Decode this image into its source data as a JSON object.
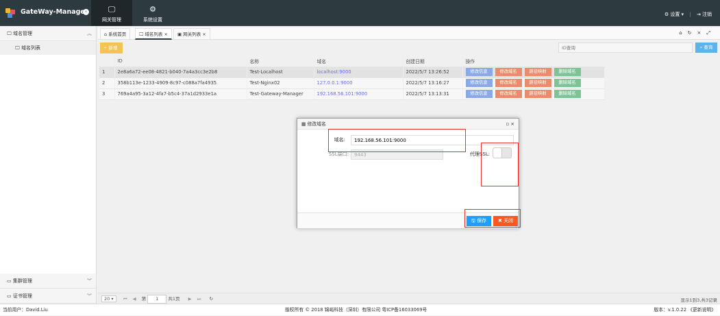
{
  "header": {
    "app_title": "GateWay-Manager",
    "nav": [
      {
        "label": "网关管理",
        "icon": "monitor-icon"
      },
      {
        "label": "系统设置",
        "icon": "gear-icon"
      }
    ],
    "settings_label": "设置",
    "logout_label": "注销"
  },
  "sidebar": {
    "groups": [
      {
        "label": "域名管理",
        "items": [
          "域名列表"
        ]
      },
      {
        "label": "集群管理"
      },
      {
        "label": "证书管理"
      }
    ]
  },
  "tabs": [
    {
      "label": "系统首页",
      "icon": "home-icon"
    },
    {
      "label": "域名列表",
      "icon": "monitor-icon",
      "active": true
    },
    {
      "label": "网关列表",
      "icon": "image-icon"
    }
  ],
  "toolbar": {
    "add_label": "新增",
    "search_placeholder": "ID查询",
    "search_label": "查询"
  },
  "table": {
    "columns": [
      "",
      "ID",
      "名称",
      "域名",
      "创建日期",
      "操作"
    ],
    "rows": [
      {
        "n": "1",
        "id": "2e8a6a72-ee08-4821-b040-7a4a3cc3e2b8",
        "name": "Test-Localhost",
        "domain": "localhost:9000",
        "date": "2022/5/7 13:26:52"
      },
      {
        "n": "2",
        "id": "358b113e-1233-4909-8c97-c088a7fa4935",
        "name": "Test-Nginx02",
        "domain": "127.0.0.1:9000",
        "date": "2022/5/7 13:16:27"
      },
      {
        "n": "3",
        "id": "769a4a95-3a12-4fa7-b5c4-37a1d2933e1a",
        "name": "Test-Gateway-Manager",
        "domain": "192.168.56.101:9000",
        "date": "2022/5/7 13:13:31"
      }
    ],
    "actions": [
      {
        "label": "修改信息",
        "color": "#8aa9e6"
      },
      {
        "label": "修改域名",
        "color": "#ee8a6c"
      },
      {
        "label": "路径映射",
        "color": "#ee8a6c"
      },
      {
        "label": "删除域名",
        "color": "#7cc495"
      }
    ]
  },
  "pager": {
    "page_size": "20",
    "page_prefix": "第",
    "page": "1",
    "page_total": "共1页",
    "summary": "显示1到3,共3记录"
  },
  "dialog": {
    "title": "修改域名",
    "domain_label": "域名:",
    "domain_value": "192.168.56.101:9000",
    "ssl_port_label": "SSL端口:",
    "ssl_port_value": "9443",
    "proxy_ssl_label": "代理SSL:",
    "proxy_ssl_on": false,
    "save_label": "保存",
    "close_label": "关闭"
  },
  "footer": {
    "user": "当前用户：David.Liu",
    "copyright": "版权所有 © 2018 锦峪科技（深圳）有限公司 粤ICP备16033069号",
    "version": "版本：v.1.0.22 《更新说明》"
  }
}
